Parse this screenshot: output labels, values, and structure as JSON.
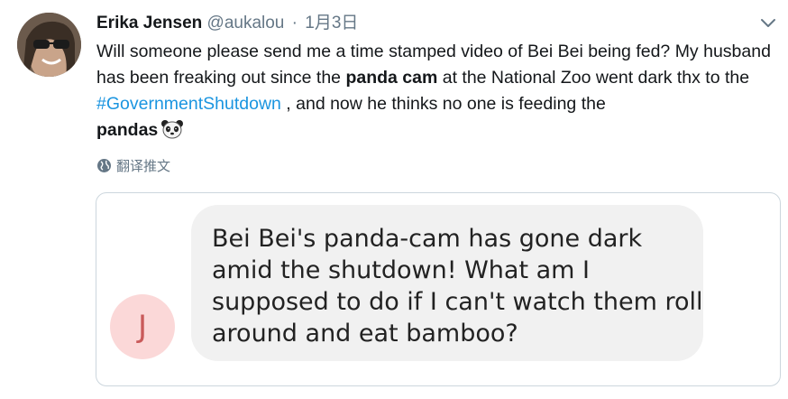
{
  "tweet": {
    "author_name": "Erika Jensen",
    "handle": "@aukalou",
    "separator": "·",
    "date": "1月3日",
    "avatar_icon": "user-avatar-photo",
    "menu_icon": "chevron-down-icon",
    "text": {
      "part1": "Will someone please send me a time stamped video of Bei Bei being fed? My husband has been freaking out since the ",
      "bold1": "panda cam",
      "part2": " at the National Zoo went dark thx to the ",
      "hashtag": "#GovernmentShutdown",
      "part3": " , and now he thinks no one is feeding the ",
      "bold2": "pandas",
      "emoji": "panda-face-emoji"
    },
    "translate_label": "翻译推文",
    "translate_icon": "globe-icon",
    "hashtag_color": "#1b95e0"
  },
  "quoted_card": {
    "avatar_letter": "J",
    "avatar_bg": "#fbd8d8",
    "avatar_fg": "#c95a5a",
    "lines": [
      "Bei Bei's panda-cam has gone dark",
      "amid the shutdown! What am I",
      "supposed to do if I can't watch them roll",
      "around and eat bamboo?"
    ]
  }
}
